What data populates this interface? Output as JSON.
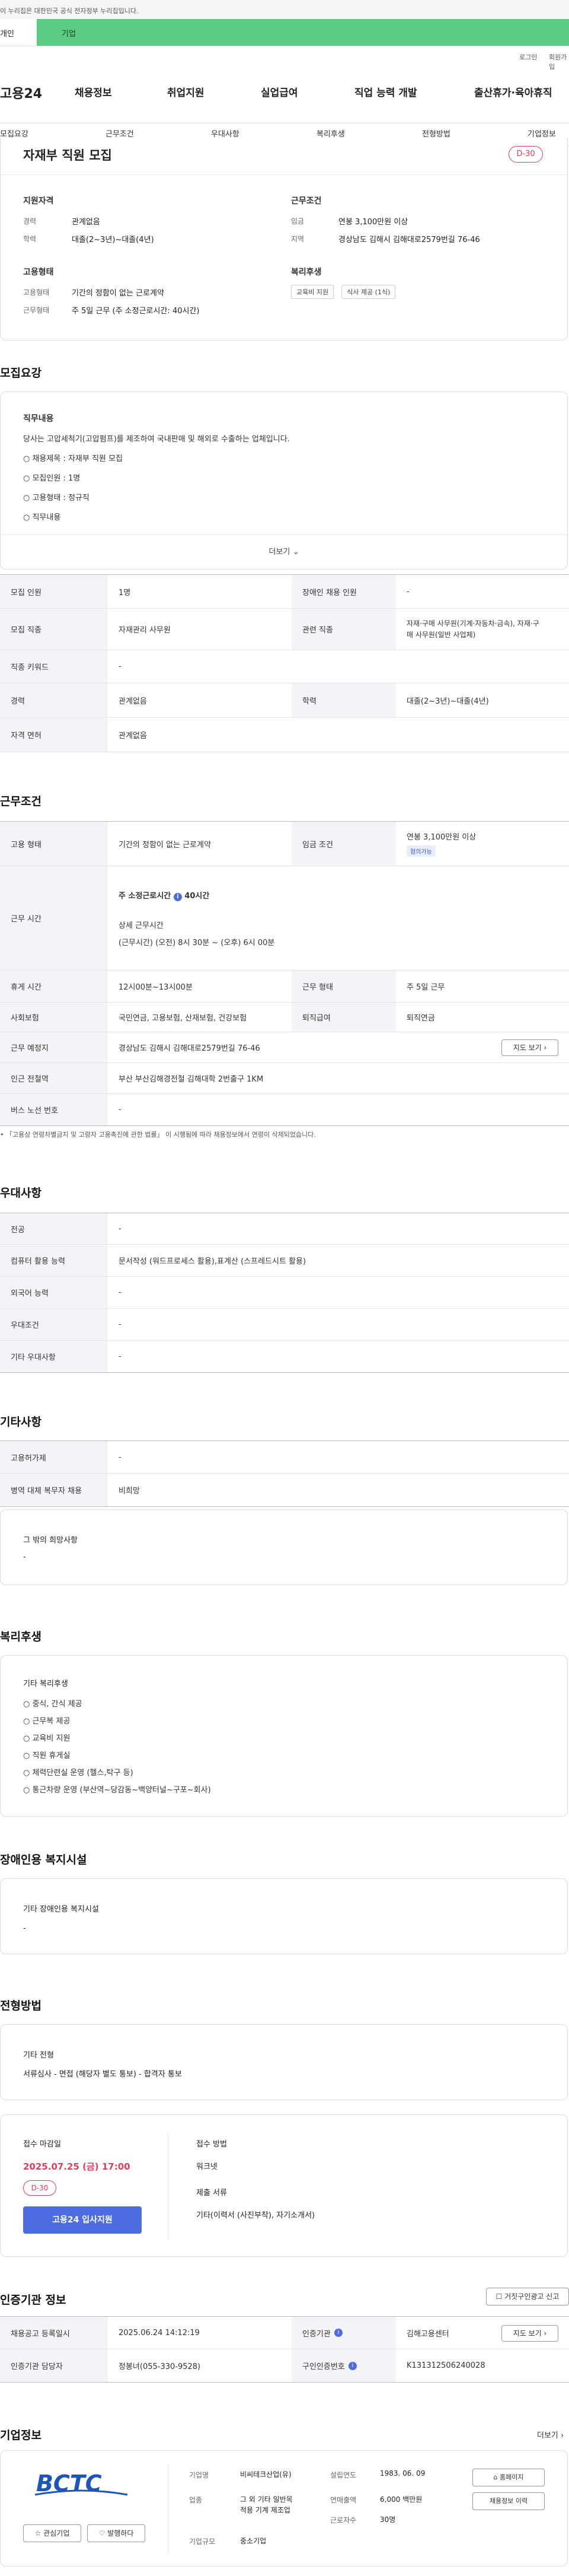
{
  "gov_banner": "이 누리집은 대한민국 공식 전자정부 누리집입니다.",
  "top_tabs": {
    "personal": "개인",
    "company": "기업"
  },
  "util": {
    "login": "로그인",
    "join": "회원가입"
  },
  "logo": "고용24",
  "gnb": [
    "채용정보",
    "취업지원",
    "실업급여",
    "직업 능력 개발",
    "출산휴가·육아휴직"
  ],
  "snb": [
    "모집요강",
    "근무조건",
    "우대사항",
    "복리후생",
    "전형방법",
    "기업정보"
  ],
  "summary": {
    "title": "자재부 직원 모집",
    "dday": "D-30",
    "qual_title": "지원자격",
    "career_label": "경력",
    "career": "관계없음",
    "edu_label": "학력",
    "edu": "대졸(2~3년)~대졸(4년)",
    "cond_title": "근무조건",
    "pay_label": "임금",
    "pay": "연봉 3,100만원 이상",
    "region_label": "지역",
    "region": "경상남도 김해시 김해대로2579번길 76-46",
    "emp_title": "고용형태",
    "emp_label": "고용형태",
    "emp": "기간의 정함이 없는 근로계약",
    "hours_label": "근무형태",
    "hours": "주 5일 근무 (주 소정근로시간: 40시간)",
    "welfare_title": "복리후생",
    "welfare_chips": [
      "교육비 지원",
      "식사 제공 (1식)"
    ]
  },
  "recruit": {
    "section": "모집요강",
    "content_title": "직무내용",
    "intro": "당사는 고압세척기(고압펌프)를 제조하여 국내판매 및 해외로 수출하는 업체입니다.",
    "lines": [
      "○ 채용제목 : 자재부 직원 모집",
      "○ 모집인원 : 1명",
      "○ 고용형태 : 정규직",
      "○ 직무내용"
    ],
    "more": "더보기",
    "table": [
      {
        "k1": "모집 인원",
        "v1": "1명",
        "k2": "장애인 채용 인원",
        "v2": "-"
      },
      {
        "k1": "모집 직종",
        "v1": "자재관리 사무원",
        "k2": "관련 직종",
        "v2a": "자재·구매 사무원(기계·자동차·금속), 자재·구",
        "v2b": "매 사무원(일반 사업체)"
      },
      {
        "k1": "직종 키워드",
        "v1": "-"
      },
      {
        "k1": "경력",
        "v1": "관계없음",
        "k2": "학력",
        "v2": "대졸(2~3년)~대졸(4년)"
      },
      {
        "k1": "자격 면허",
        "v1": "관계없음"
      }
    ]
  },
  "work": {
    "section": "근무조건",
    "emp_k": "고용 형태",
    "emp_v": "기간의 정함이 없는 근로계약",
    "pay_k": "임금 조건",
    "pay_v": "연봉 3,100만원 이상",
    "pay_badge": "협의가능",
    "time_k": "근무 시간",
    "time_main": "주 소정근로시간",
    "time_hours": "40시간",
    "time_sub": "상세 근무시간",
    "time_detail": "(근무시간) (오전) 8시 30분 ~ (오후) 6시 00분",
    "rest_k": "휴게 시간",
    "rest_v": "12시00분~13시00분",
    "type_k": "근무 형태",
    "type_v": "주 5일 근무",
    "ins_k": "사회보험",
    "ins_v": "국민연금, 고용보험, 산재보험, 건강보험",
    "ret_k": "퇴직급여",
    "ret_v": "퇴직연금",
    "loc_k": "근무 예정지",
    "loc_v": "경상남도 김해시 김해대로2579번길 76-46",
    "map_btn": "지도 보기",
    "subway_k": "인근 전철역",
    "subway_v": "부산 부산김해경전철 김해대학 2번출구 1KM",
    "bus_k": "버스 노선 번호",
    "bus_v": "-",
    "note": "「고용상 연령차별금지 및 고령자 고용촉진에 관한 법률」 이 시행됨에 따라 채용정보에서 연령이 삭제되었습니다."
  },
  "pref": {
    "section": "우대사항",
    "rows": [
      {
        "k": "전공",
        "v": "-"
      },
      {
        "k": "컴퓨터 활용 능력",
        "v": "문서작성 (워드프로세스 활용),표계산 (스프레드시트 활용)"
      },
      {
        "k": "외국어 능력",
        "v": "-"
      },
      {
        "k": "우대조건",
        "v": "-"
      },
      {
        "k": "기타 우대사항",
        "v": "-"
      }
    ]
  },
  "etc": {
    "section": "기타사항",
    "rows": [
      {
        "k": "고용허가제",
        "v": "-"
      },
      {
        "k": "병역 대체 복무자 채용",
        "v": "비희망"
      }
    ],
    "wish_title": "그 밖의 희망사항",
    "wish_v": "-"
  },
  "welfare": {
    "section": "복리후생",
    "title": "기타 복리후생",
    "items": [
      "○ 중식, 간식 제공",
      "○ 근무복 제공",
      "○ 교육비 지원",
      "○ 직원 휴게실",
      "○ 체력단련실 운영 (헬스,탁구 등)",
      "○ 통근차량 운영 (부산역~당감동~백양터널~구포~회사)"
    ]
  },
  "disabled": {
    "section": "장애인용 복지시설",
    "title": "기타 장애인용 복지시설",
    "v": "-"
  },
  "selection": {
    "section": "전형방법",
    "title": "기타 전형",
    "steps": "서류심사 - 면접 (해당자 별도 통보) - 합격자 통보",
    "deadline_label": "접수 마감일",
    "deadline": "2025.07.25 (금) 17:00",
    "dday": "D-30",
    "apply_btn": "고용24 입사지원",
    "method_label": "접수 방법",
    "method": "워크넷",
    "docs_label": "제출 서류",
    "docs": "기타(이력서 (사진부착), 자기소개서)"
  },
  "agency": {
    "section": "인증기관 정보",
    "report_btn": "거짓구인광고 신고",
    "k1": "채용공고 등록일시",
    "v1": "2025.06.24 14:12:19",
    "k2": "인증기관",
    "v2": "김해고용센터",
    "map_btn": "지도 보기",
    "k3": "인증기관 담당자",
    "v3": "정봉녀(055-330-9528)",
    "k4": "구인인증번호",
    "v4": "K131312506240028"
  },
  "company": {
    "section": "기업정보",
    "more": "더보기",
    "logo": "BCTC",
    "name_k": "기업명",
    "name_v": "비씨테크산업(유)",
    "ind_k": "업종",
    "ind_v1": "그 외 기타 일반목",
    "ind_v2": "적용 기계 제조업",
    "scale_k": "기업규모",
    "scale_v": "중소기업",
    "year_k": "설립연도",
    "year_v": "1983. 06. 09",
    "sales_k": "연매출액",
    "sales_v": "6,000 백만원",
    "staff_k": "근로자수",
    "staff_v": "30명",
    "fav_btn": "관심기업",
    "follow_btn": "발행하다",
    "home_btn": "홈페이지",
    "jobs_btn": "채용정보 이력"
  },
  "colors": {
    "accent": "#4d6cdf",
    "green": "#5ccb82",
    "dday": "#e63b5a"
  }
}
